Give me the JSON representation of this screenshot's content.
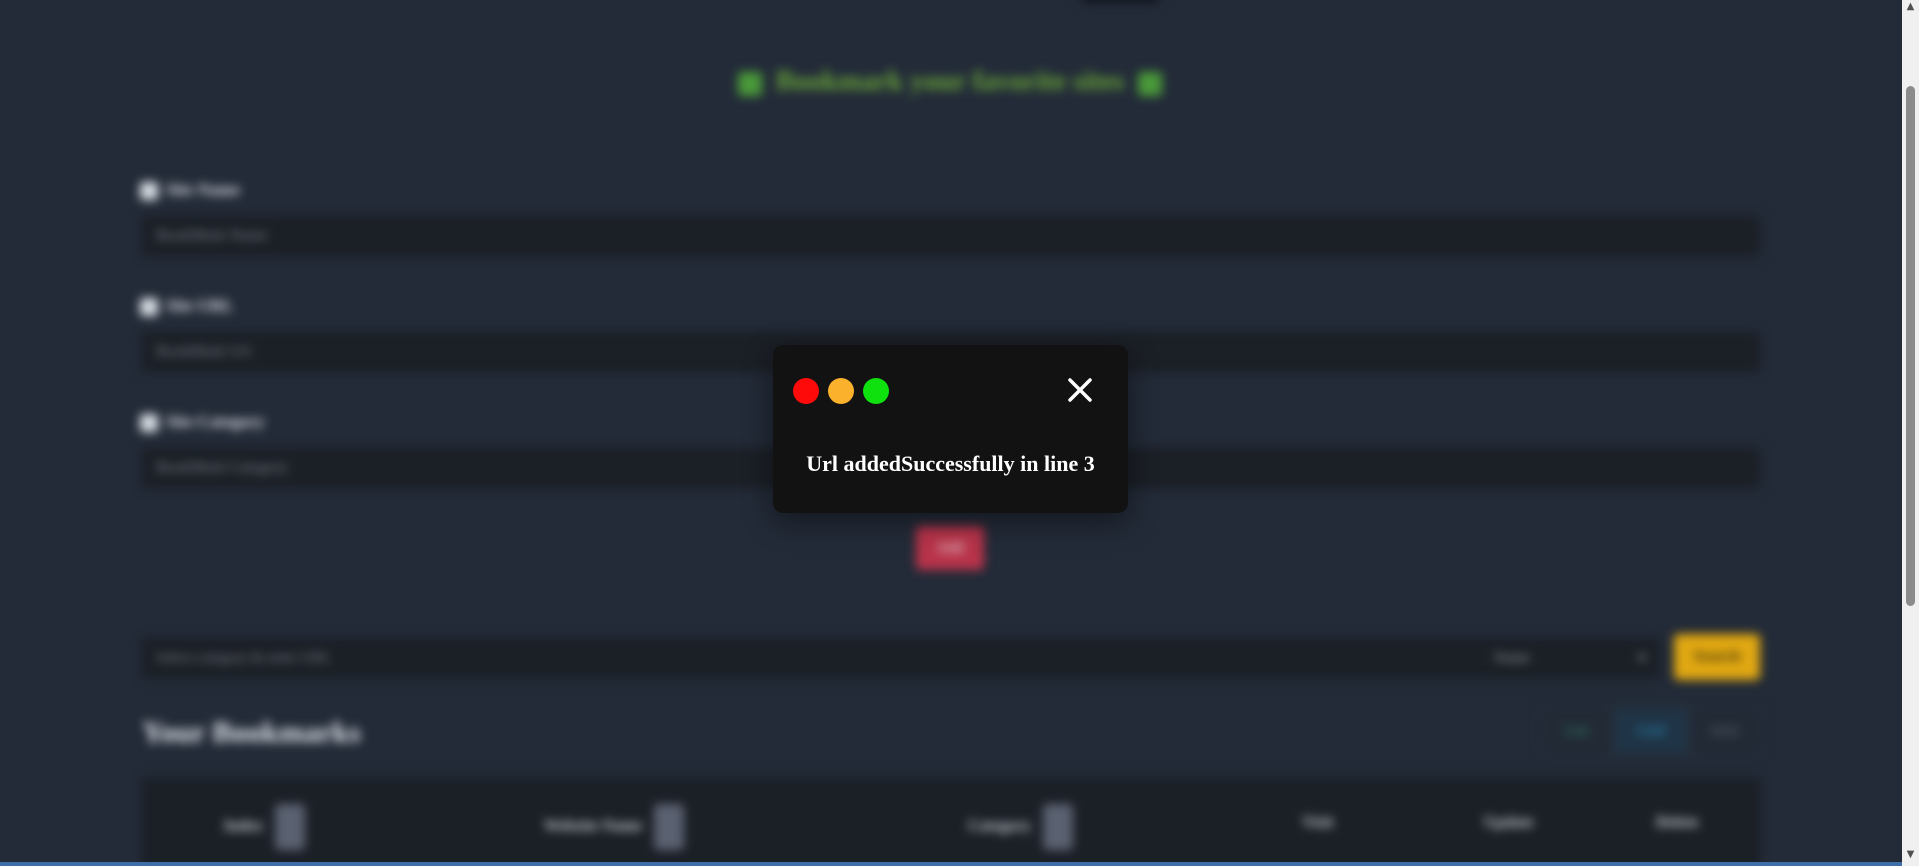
{
  "form": {
    "heading": "Bookmark your favorite sites",
    "site_name_label": "Site Name",
    "site_name_placeholder": "BookMark Name",
    "site_url_label": "Site URL",
    "site_url_placeholder": "BookMark Url",
    "site_category_label": "Site Category",
    "site_category_placeholder": "BookMark Category",
    "add_label": "Add"
  },
  "search": {
    "placeholder": "Select category & enter URL",
    "filter_value": "Name",
    "button_label": "Search"
  },
  "bookmarks": {
    "title": "Your Bookmarks",
    "view_buttons": [
      "List",
      "Grid",
      "Hide"
    ],
    "columns": [
      "Index",
      "Website Name",
      "Category",
      "Visit",
      "Update",
      "Delete"
    ]
  },
  "modal": {
    "message": "Url addedSuccessfully in line 3",
    "colors": {
      "close_dot": "#ff0a0a",
      "minimize_dot": "#fbb12c",
      "maximize_dot": "#0ee10e"
    }
  },
  "icons": {
    "close": "close-x-icon",
    "heading": "bookmark-icon",
    "scroll_up": "scroll-up-arrow-icon",
    "scroll_down": "scroll-down-arrow-icon"
  }
}
